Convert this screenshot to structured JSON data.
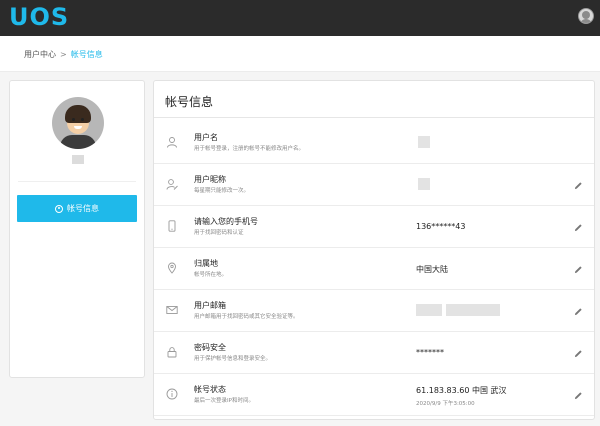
{
  "header": {
    "logo": "UOS",
    "user_avatar_icon": "user-avatar-icon"
  },
  "breadcrumb": {
    "home": "用户中心",
    "separator": ">",
    "current": "帐号信息"
  },
  "sidebar": {
    "nav_label": "帐号信息",
    "nav_icon": "user-circle-icon"
  },
  "main": {
    "title": "帐号信息",
    "rows": [
      {
        "label": "用户名",
        "desc": "用于帐号登录，注册的帐号不能修改用户名。",
        "value": "",
        "icon": "user-icon",
        "editable": false
      },
      {
        "label": "用户昵称",
        "desc": "每星期只能修改一次。",
        "value": "",
        "icon": "user-edit-icon",
        "editable": true
      },
      {
        "label": "请输入您的手机号",
        "desc": "用于找回密码和认证",
        "value": "136******43",
        "icon": "phone-icon",
        "editable": true
      },
      {
        "label": "归属地",
        "desc": "帐号所在地。",
        "value": "中国大陆",
        "icon": "location-icon",
        "editable": true
      },
      {
        "label": "用户邮箱",
        "desc": "用户邮箱用于找回密码或其它安全验证等。",
        "value": "",
        "icon": "mail-icon",
        "editable": true
      },
      {
        "label": "密码安全",
        "desc": "用于保护帐号信息和登录安全。",
        "value": "*******",
        "icon": "lock-icon",
        "editable": true
      },
      {
        "label": "帐号状态",
        "desc": "最后一次登录IP和时间。",
        "value": "61.183.83.60 中国 武汉",
        "sub": "2020/9/9 下午3:05:00",
        "icon": "info-icon",
        "editable": true
      }
    ]
  },
  "colors": {
    "accent": "#1fb9ea",
    "topbar": "#2b2b2b"
  }
}
